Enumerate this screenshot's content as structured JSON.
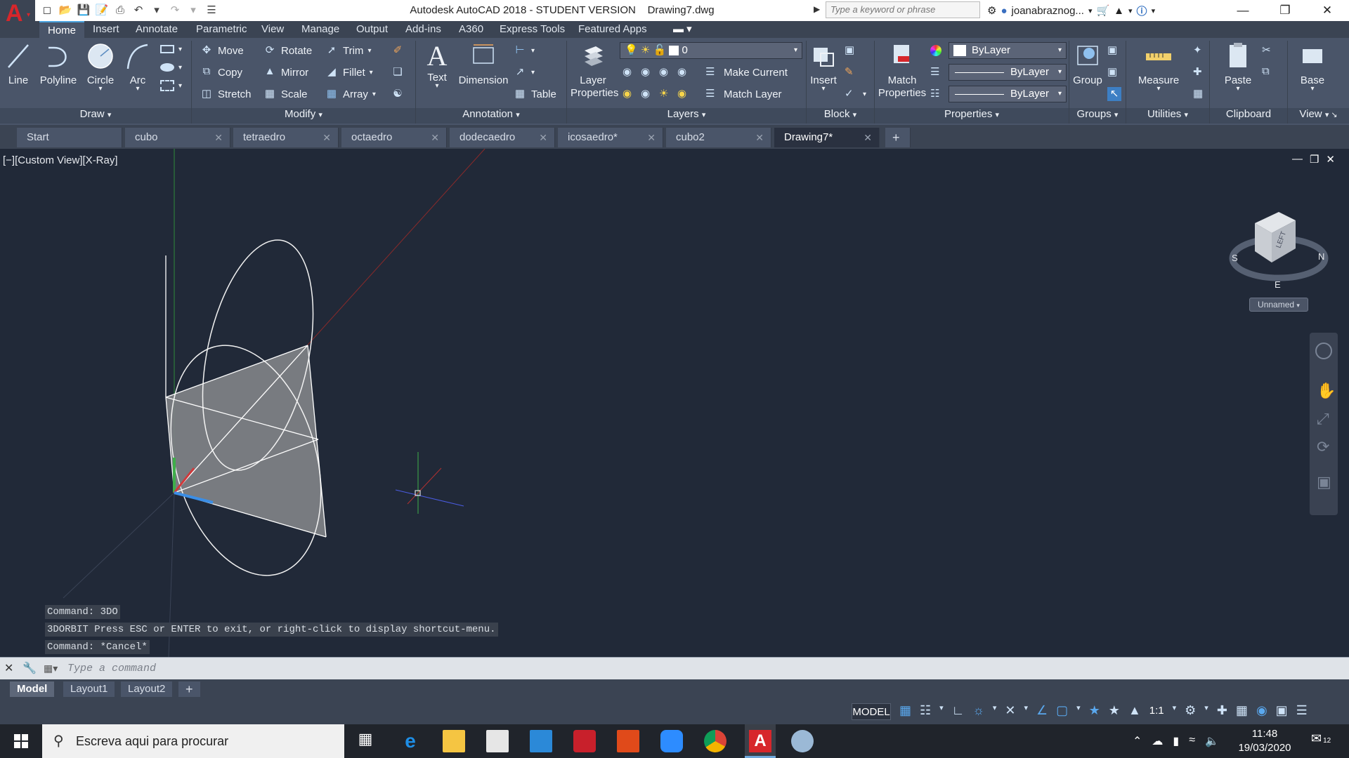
{
  "titlebar": {
    "title": "Autodesk AutoCAD 2018 - STUDENT VERSION    Drawing7.dwg",
    "search_placeholder": "Type a keyword or phrase",
    "username": "joanabraznog..."
  },
  "ribbon_tabs": [
    "Home",
    "Insert",
    "Annotate",
    "Parametric",
    "View",
    "Manage",
    "Output",
    "Add-ins",
    "A360",
    "Express Tools",
    "Featured Apps"
  ],
  "ribbon": {
    "draw": {
      "line": "Line",
      "polyline": "Polyline",
      "circle": "Circle",
      "arc": "Arc",
      "panel": "Draw"
    },
    "modify": {
      "move": "Move",
      "rotate": "Rotate",
      "trim": "Trim",
      "copy": "Copy",
      "mirror": "Mirror",
      "fillet": "Fillet",
      "stretch": "Stretch",
      "scale": "Scale",
      "array": "Array",
      "panel": "Modify"
    },
    "annotation": {
      "text": "Text",
      "dimension": "Dimension",
      "table": "Table",
      "panel": "Annotation"
    },
    "layers": {
      "layer_properties_1": "Layer",
      "layer_properties_2": "Properties",
      "current_layer": "0",
      "make_current": "Make Current",
      "match_layer": "Match Layer",
      "panel": "Layers"
    },
    "block": {
      "insert": "Insert",
      "panel": "Block"
    },
    "properties": {
      "match_1": "Match",
      "match_2": "Properties",
      "color": "ByLayer",
      "linetype": "ByLayer",
      "lineweight": "ByLayer",
      "panel": "Properties"
    },
    "groups": {
      "group": "Group",
      "panel": "Groups"
    },
    "utilities": {
      "measure": "Measure",
      "panel": "Utilities"
    },
    "clipboard": {
      "paste": "Paste",
      "panel": "Clipboard"
    },
    "view": {
      "base": "Base",
      "panel": "View"
    }
  },
  "doc_tabs": [
    {
      "label": "Start"
    },
    {
      "label": "cubo"
    },
    {
      "label": "tetraedro"
    },
    {
      "label": "octaedro"
    },
    {
      "label": "dodecaedro"
    },
    {
      "label": "icosaedro*"
    },
    {
      "label": "cubo2"
    },
    {
      "label": "Drawing7*"
    }
  ],
  "viewport": {
    "label": "[−][Custom View][X-Ray]",
    "viewcube_label": "Unnamed",
    "compass": {
      "s": "S",
      "n": "N",
      "e": "E"
    },
    "cube_face": "LEFT"
  },
  "command_history": [
    "Command: 3DO",
    "3DORBIT Press ESC or ENTER to exit, or right-click to display shortcut-menu.",
    "Command: *Cancel*"
  ],
  "command_input_placeholder": "Type a command",
  "layout_tabs": [
    "Model",
    "Layout1",
    "Layout2"
  ],
  "status": {
    "model": "MODEL",
    "scale": "1:1"
  },
  "taskbar": {
    "search_text": "Escreva aqui para procurar",
    "time": "11:48",
    "date": "19/03/2020",
    "notifications": "12"
  },
  "colors": {
    "accent": "#4aa3df",
    "autocad_red": "#d7262b",
    "viewport_bg": "#212938",
    "ribbon_bg": "#4a5569"
  }
}
